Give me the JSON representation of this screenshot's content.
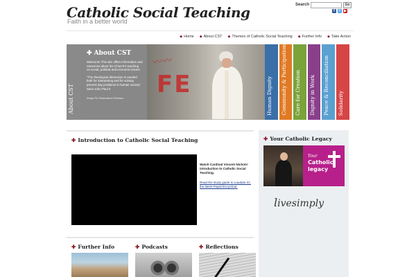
{
  "header": {
    "site_title": "Catholic Social Teaching",
    "tagline": "Faith in a better world",
    "search": {
      "label": "Search",
      "placeholder": "",
      "button": "Go"
    },
    "social": [
      {
        "icon": "facebook-icon",
        "glyph": "f",
        "color": "#3b5998"
      },
      {
        "icon": "twitter-icon",
        "glyph": "t",
        "color": "#55acee"
      },
      {
        "icon": "youtube-icon",
        "glyph": "▶",
        "color": "#cc181e"
      }
    ]
  },
  "nav": {
    "items": [
      "Home",
      "About CST",
      "Themes of Catholic Social Teaching",
      "Further Info",
      "Take Action"
    ]
  },
  "hero": {
    "side_label": "About CST",
    "heading": "About CST",
    "intro": "Welcome! This site offers information and resources about the Church's teaching on social, political and economic issues.",
    "quote": "\"The theological dimension is needed both for interpreting and for solving present day problems in human society\" Saint John Paul II",
    "credit": "Image ©L'Osservatore Romano",
    "photo_graffiti": "FE"
  },
  "themes": [
    {
      "label": "Human Dignity",
      "color": "#3a6fa8"
    },
    {
      "label": "Community & Participation",
      "color": "#e07a25"
    },
    {
      "label": "Care for Creation",
      "color": "#7aa33a"
    },
    {
      "label": "Dignity in Work",
      "color": "#8a3f8a"
    },
    {
      "label": "Peace & Reconciliation",
      "color": "#5aa0d0"
    },
    {
      "label": "Solidarity",
      "color": "#d64545"
    }
  ],
  "intro": {
    "heading": "Introduction to Catholic Social Teaching",
    "video_caption": "Watch Cardinal Vincent Nichols' introduction to Catholic Social Teaching.",
    "study_link": "Read the study guide to Laudato Si', the latest Papal Encyclical."
  },
  "legacy": {
    "heading": "Your Catholic Legacy",
    "graphic_your": "Your",
    "graphic_catholic": "Catholic",
    "graphic_legacy": "legacy",
    "livesimply_prefix": "l",
    "livesimply_main": "ivesimply"
  },
  "bottom": {
    "further_info": "Further Info",
    "podcasts": "Podcasts",
    "reflections": "Reflections"
  },
  "colors": {
    "accent": "#8a1a2a",
    "about_panel": "#888888",
    "link": "#1a3a8a"
  }
}
